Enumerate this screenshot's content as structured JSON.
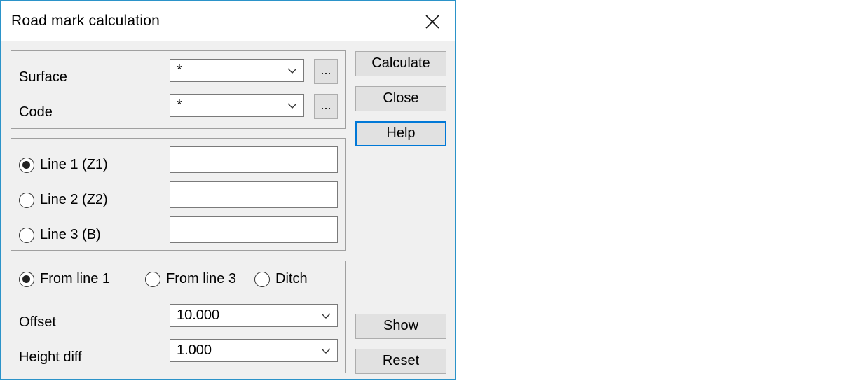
{
  "window": {
    "title": "Road mark calculation"
  },
  "surface": {
    "label": "Surface",
    "value": "*",
    "browse_label": "..."
  },
  "code": {
    "label": "Code",
    "value": "*",
    "browse_label": "..."
  },
  "lines": [
    {
      "label": "Line 1  (Z1)",
      "selected": true,
      "value": ""
    },
    {
      "label": "Line 2  (Z2)",
      "selected": false,
      "value": ""
    },
    {
      "label": "Line 3  (B)",
      "selected": false,
      "value": ""
    }
  ],
  "reference": {
    "options": [
      {
        "label": "From line 1",
        "selected": true
      },
      {
        "label": "From line 3",
        "selected": false
      },
      {
        "label": "Ditch",
        "selected": false
      }
    ]
  },
  "offset": {
    "label": "Offset",
    "value": "10.000"
  },
  "height_diff": {
    "label": "Height diff",
    "value": "1.000"
  },
  "buttons": {
    "calculate": "Calculate",
    "close": "Close",
    "help": "Help",
    "show": "Show",
    "reset": "Reset"
  },
  "icons": {
    "close": "close-icon",
    "dropdown": "chevron-down-icon"
  }
}
